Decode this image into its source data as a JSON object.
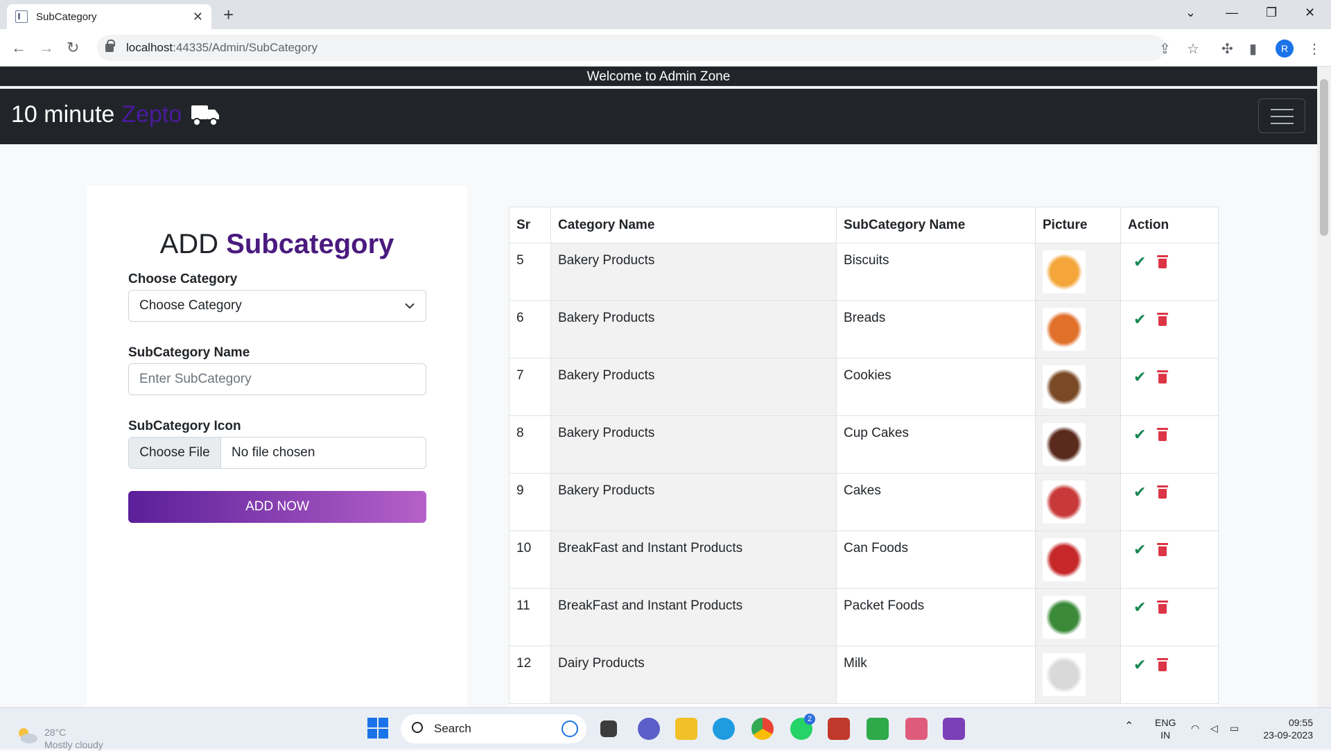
{
  "browser": {
    "tab_title": "SubCategory",
    "url_host": "localhost",
    "url_path": ":44335/Admin/SubCategory",
    "profile_initial": "R"
  },
  "app": {
    "welcome": "Welcome to Admin Zone",
    "brand_main": "10 minute",
    "brand_accent": "Zepto"
  },
  "form": {
    "title_plain": "ADD",
    "title_accent": "Subcategory",
    "category_label": "Choose Category",
    "category_selected": "Choose Category",
    "subcategory_label": "SubCategory Name",
    "subcategory_placeholder": "Enter SubCategory",
    "icon_label": "SubCategory Icon",
    "file_button": "Choose File",
    "file_status": "No file chosen",
    "submit_label": "ADD NOW"
  },
  "table": {
    "headers": [
      "Sr",
      "Category Name",
      "SubCategory Name",
      "Picture",
      "Action"
    ],
    "rows": [
      {
        "sr": "5",
        "category": "Bakery Products",
        "subcategory": "Biscuits",
        "thumb_color": "#f4a63a"
      },
      {
        "sr": "6",
        "category": "Bakery Products",
        "subcategory": "Breads",
        "thumb_color": "#e0702a"
      },
      {
        "sr": "7",
        "category": "Bakery Products",
        "subcategory": "Cookies",
        "thumb_color": "#7a4a26"
      },
      {
        "sr": "8",
        "category": "Bakery Products",
        "subcategory": "Cup Cakes",
        "thumb_color": "#5a2a1c"
      },
      {
        "sr": "9",
        "category": "Bakery Products",
        "subcategory": "Cakes",
        "thumb_color": "#c83a3a"
      },
      {
        "sr": "10",
        "category": "BreakFast and Instant Products",
        "subcategory": "Can Foods",
        "thumb_color": "#c6282a"
      },
      {
        "sr": "11",
        "category": "BreakFast and Instant Products",
        "subcategory": "Packet Foods",
        "thumb_color": "#3a8a3a"
      },
      {
        "sr": "12",
        "category": "Dairy Products",
        "subcategory": "Milk",
        "thumb_color": "#d9d9d9"
      }
    ]
  },
  "taskbar": {
    "weather_temp": "28°C",
    "weather_desc": "Mostly cloudy",
    "search_label": "Search",
    "lang_top": "ENG",
    "lang_bottom": "IN",
    "time": "09:55",
    "date": "23-09-2023",
    "whatsapp_badge": "2"
  },
  "colors": {
    "brand_accent": "#4a1a9e",
    "check": "#198754",
    "trash": "#dc3545"
  }
}
